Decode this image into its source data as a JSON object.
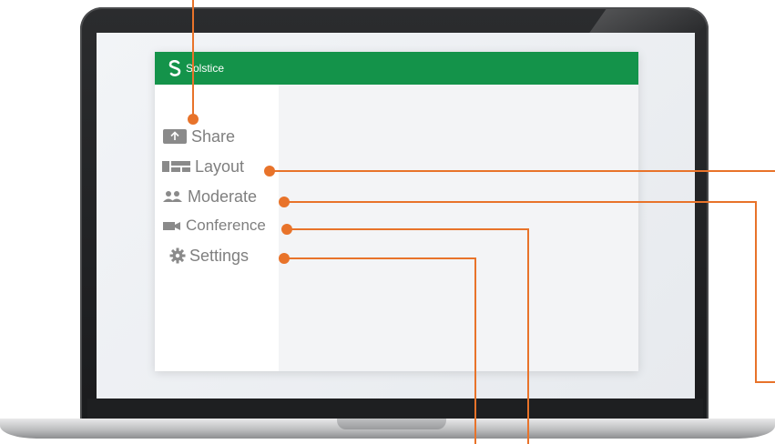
{
  "app": {
    "name": "Solstice",
    "brand_color": "#14934a"
  },
  "callout_color": "#e8732a",
  "menu": [
    {
      "label": "Share",
      "icon": "upload-arrow-icon"
    },
    {
      "label": "Layout",
      "icon": "layout-grid-icon"
    },
    {
      "label": "Moderate",
      "icon": "users-icon"
    },
    {
      "label": "Conference",
      "icon": "video-camera-icon"
    },
    {
      "label": "Settings",
      "icon": "gear-icon"
    }
  ]
}
